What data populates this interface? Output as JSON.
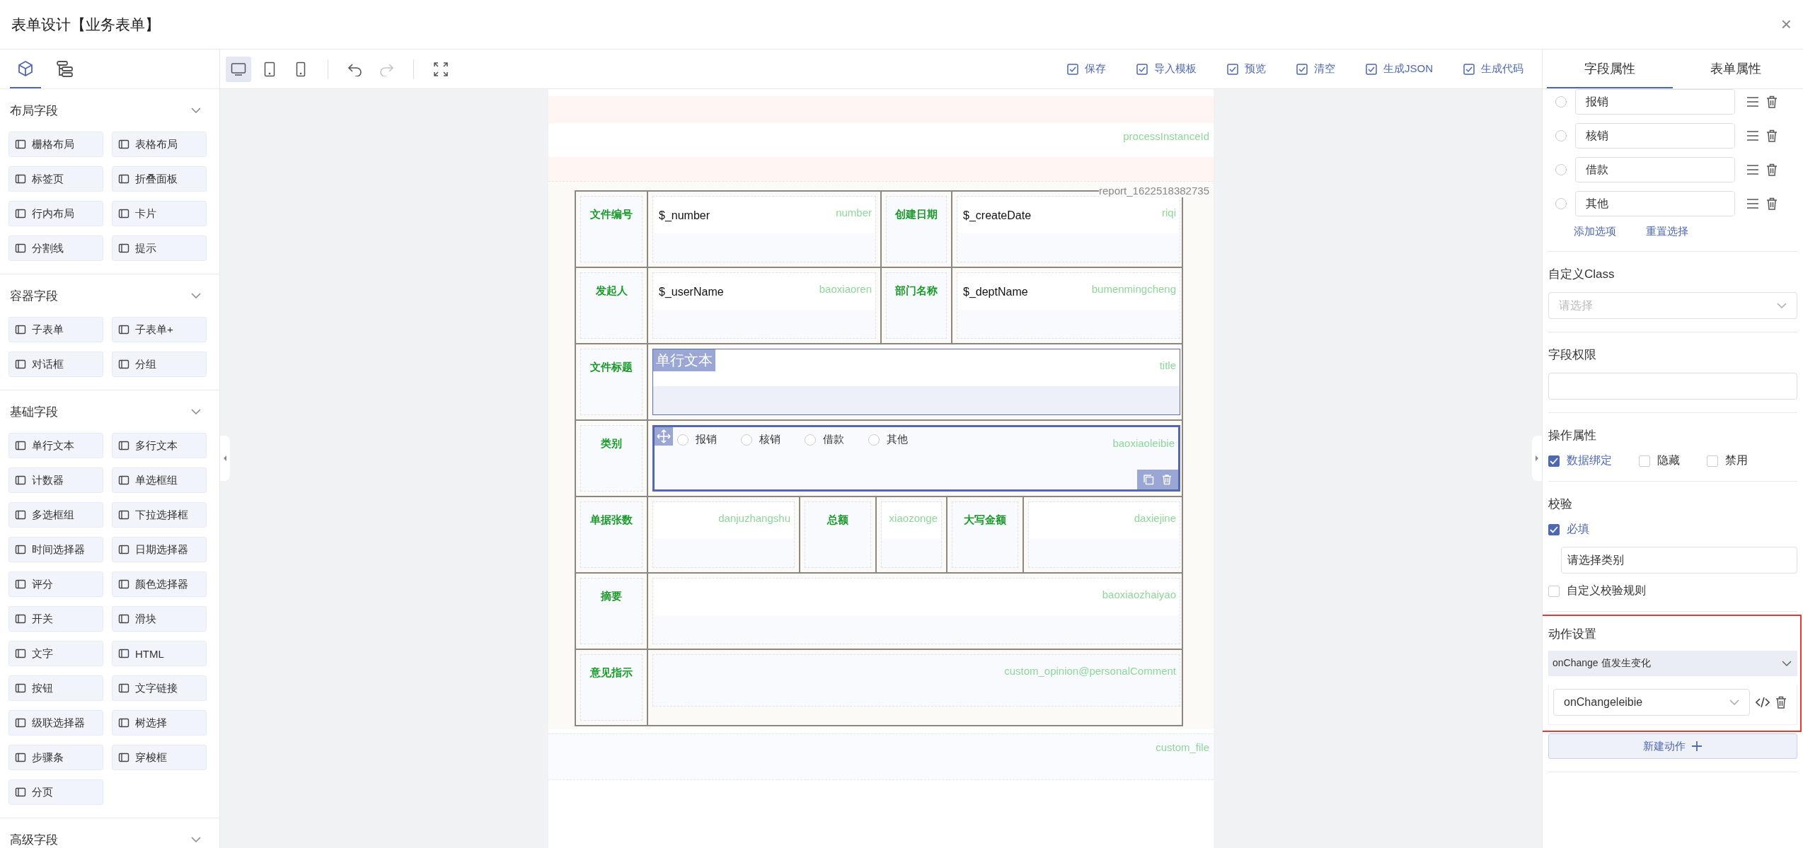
{
  "window": {
    "title": "表单设计【业务表单】",
    "close": "×"
  },
  "palette": {
    "tabs": [
      {
        "kind": "components",
        "selected": true
      },
      {
        "kind": "outline",
        "selected": false
      }
    ],
    "groups": [
      {
        "title": "布局字段",
        "items": [
          "栅格布局",
          "表格布局",
          "标签页",
          "折叠面板",
          "行内布局",
          "卡片",
          "分割线",
          "提示"
        ]
      },
      {
        "title": "容器字段",
        "items": [
          "子表单",
          "子表单+",
          "对话框",
          "分组"
        ]
      },
      {
        "title": "基础字段",
        "items": [
          "单行文本",
          "多行文本",
          "计数器",
          "单选框组",
          "多选框组",
          "下拉选择框",
          "时间选择器",
          "日期选择器",
          "评分",
          "颜色选择器",
          "开关",
          "滑块",
          "文字",
          "HTML",
          "按钮",
          "文字链接",
          "级联选择器",
          "树选择",
          "步骤条",
          "穿梭框",
          "分页"
        ]
      },
      {
        "title": "高级字段"
      }
    ]
  },
  "toolbar": {
    "devices": [
      {
        "kind": "desktop",
        "selected": true
      },
      {
        "kind": "tablet",
        "selected": false
      },
      {
        "kind": "phone",
        "selected": false
      }
    ],
    "history": [
      {
        "kind": "undo",
        "disabled": false
      },
      {
        "kind": "redo",
        "disabled": true
      }
    ],
    "actions": [
      "保存",
      "导入模板",
      "预览",
      "清空",
      "生成JSON",
      "生成代码"
    ]
  },
  "canvas": {
    "top_field": {
      "tag": "processInstanceId"
    },
    "table": {
      "ref": "report_1622518382735",
      "lines": [
        {
          "items": [
            {
              "kind": "label",
              "text": "文件编号"
            },
            {
              "kind": "field",
              "value": "$_number",
              "tag": "number"
            },
            {
              "kind": "label",
              "text": "创建日期"
            },
            {
              "kind": "field",
              "value": "$_createDate",
              "tag": "riqi"
            }
          ]
        },
        {
          "items": [
            {
              "kind": "label",
              "text": "发起人"
            },
            {
              "kind": "field",
              "value": "$_userName",
              "tag": "baoxiaoren"
            },
            {
              "kind": "label",
              "text": "部门名称"
            },
            {
              "kind": "field",
              "value": "$_deptName",
              "tag": "bumenmingcheng"
            }
          ]
        },
        {
          "items": [
            {
              "kind": "label",
              "text": "文件标题"
            },
            {
              "kind": "field",
              "tag": "title",
              "hover_label": "单行文本",
              "highlighted": true
            }
          ]
        },
        {
          "items": [
            {
              "kind": "label",
              "text": "类别"
            },
            {
              "kind": "radio",
              "tag": "baoxiaoleibie",
              "selected": true,
              "options": [
                {
                  "label": "报销",
                  "selected": false
                },
                {
                  "label": "核销",
                  "selected": false
                },
                {
                  "label": "借款",
                  "selected": false
                },
                {
                  "label": "其他",
                  "selected": false
                }
              ]
            }
          ]
        },
        {
          "items": [
            {
              "kind": "label",
              "text": "单据张数"
            },
            {
              "kind": "field",
              "tag": "danjuzhangshu"
            },
            {
              "kind": "label",
              "text": "总额"
            },
            {
              "kind": "field",
              "tag": "xiaozonge"
            },
            {
              "kind": "label",
              "text": "大写金额"
            },
            {
              "kind": "field",
              "tag": "daxiejine"
            }
          ]
        },
        {
          "items": [
            {
              "kind": "label",
              "text": "摘要"
            },
            {
              "kind": "field",
              "tag": "baoxiaozhaiyao"
            }
          ]
        },
        {
          "items": [
            {
              "kind": "label",
              "text": "意见指示"
            },
            {
              "kind": "opinion",
              "tag": "custom_opinion@personalComment"
            }
          ]
        }
      ]
    },
    "bottom_field": {
      "tag": "custom_file"
    }
  },
  "properties": {
    "tabs": [
      {
        "label": "字段属性",
        "selected": true
      },
      {
        "label": "表单属性",
        "selected": false
      }
    ],
    "options": [
      {
        "label": "报销",
        "selected": false
      },
      {
        "label": "核销",
        "selected": false
      },
      {
        "label": "借款",
        "selected": false
      },
      {
        "label": "其他",
        "selected": false
      }
    ],
    "option_links": [
      "添加选项",
      "重置选择"
    ],
    "custom_class": {
      "label": "自定义Class",
      "placeholder": "请选择"
    },
    "permission": {
      "label": "字段权限"
    },
    "operations": {
      "label": "操作属性",
      "items": [
        {
          "label": "数据绑定",
          "checked": true
        },
        {
          "label": "隐藏",
          "checked": false
        },
        {
          "label": "禁用",
          "checked": false
        }
      ]
    },
    "validation": {
      "label": "校验",
      "required": {
        "label": "必填",
        "checked": true
      },
      "message": "请选择类别",
      "custom_rule": {
        "label": "自定义校验规则",
        "checked": false
      }
    },
    "actions": {
      "label": "动作设置",
      "highlighted": true,
      "event": "onChange 值发生变化",
      "handler": "onChangeleibie",
      "new_button": "新建动作"
    }
  }
}
